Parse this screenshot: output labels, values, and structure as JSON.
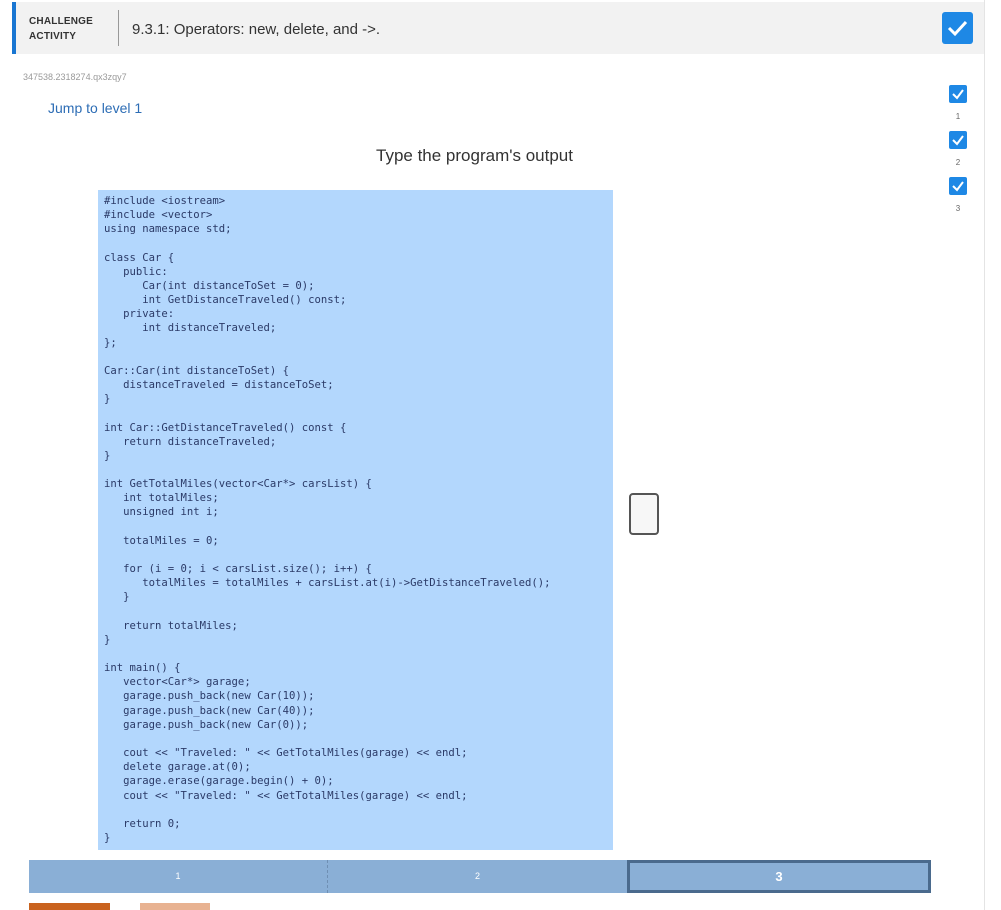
{
  "header": {
    "badge_line1": "CHALLENGE",
    "badge_line2": "ACTIVITY",
    "title": "9.3.1: Operators: new, delete, and ->."
  },
  "activity_id": "347538.2318274.qx3zqy7",
  "jump_link": "Jump to level 1",
  "prompt": "Type the program's output",
  "code": "#include <iostream>\n#include <vector>\nusing namespace std;\n\nclass Car {\n   public:\n      Car(int distanceToSet = 0);\n      int GetDistanceTraveled() const;\n   private:\n      int distanceTraveled;\n};\n\nCar::Car(int distanceToSet) {\n   distanceTraveled = distanceToSet;\n}\n\nint Car::GetDistanceTraveled() const {\n   return distanceTraveled;\n}\n\nint GetTotalMiles(vector<Car*> carsList) {\n   int totalMiles;\n   unsigned int i;\n\n   totalMiles = 0;\n\n   for (i = 0; i < carsList.size(); i++) {\n      totalMiles = totalMiles + carsList.at(i)->GetDistanceTraveled();\n   }\n\n   return totalMiles;\n}\n\nint main() {\n   vector<Car*> garage;\n   garage.push_back(new Car(10));\n   garage.push_back(new Car(40));\n   garage.push_back(new Car(0));\n\n   cout << \"Traveled: \" << GetTotalMiles(garage) << endl;\n   delete garage.at(0);\n   garage.erase(garage.begin() + 0);\n   cout << \"Traveled: \" << GetTotalMiles(garage) << endl;\n\n   return 0;\n}",
  "answer": {
    "value": ""
  },
  "levels": [
    {
      "number": "1",
      "completed": true
    },
    {
      "number": "2",
      "completed": true
    },
    {
      "number": "3",
      "completed": true
    }
  ],
  "progress": [
    {
      "label": "1",
      "current": false
    },
    {
      "label": "2",
      "current": false
    },
    {
      "label": "3",
      "current": true
    }
  ],
  "colors": {
    "accent": "#1e88e5",
    "code_background": "#b3d7fd",
    "progress_segment": "#8aafd6",
    "button_primary": "#c9621e",
    "button_secondary": "#e8b291"
  }
}
